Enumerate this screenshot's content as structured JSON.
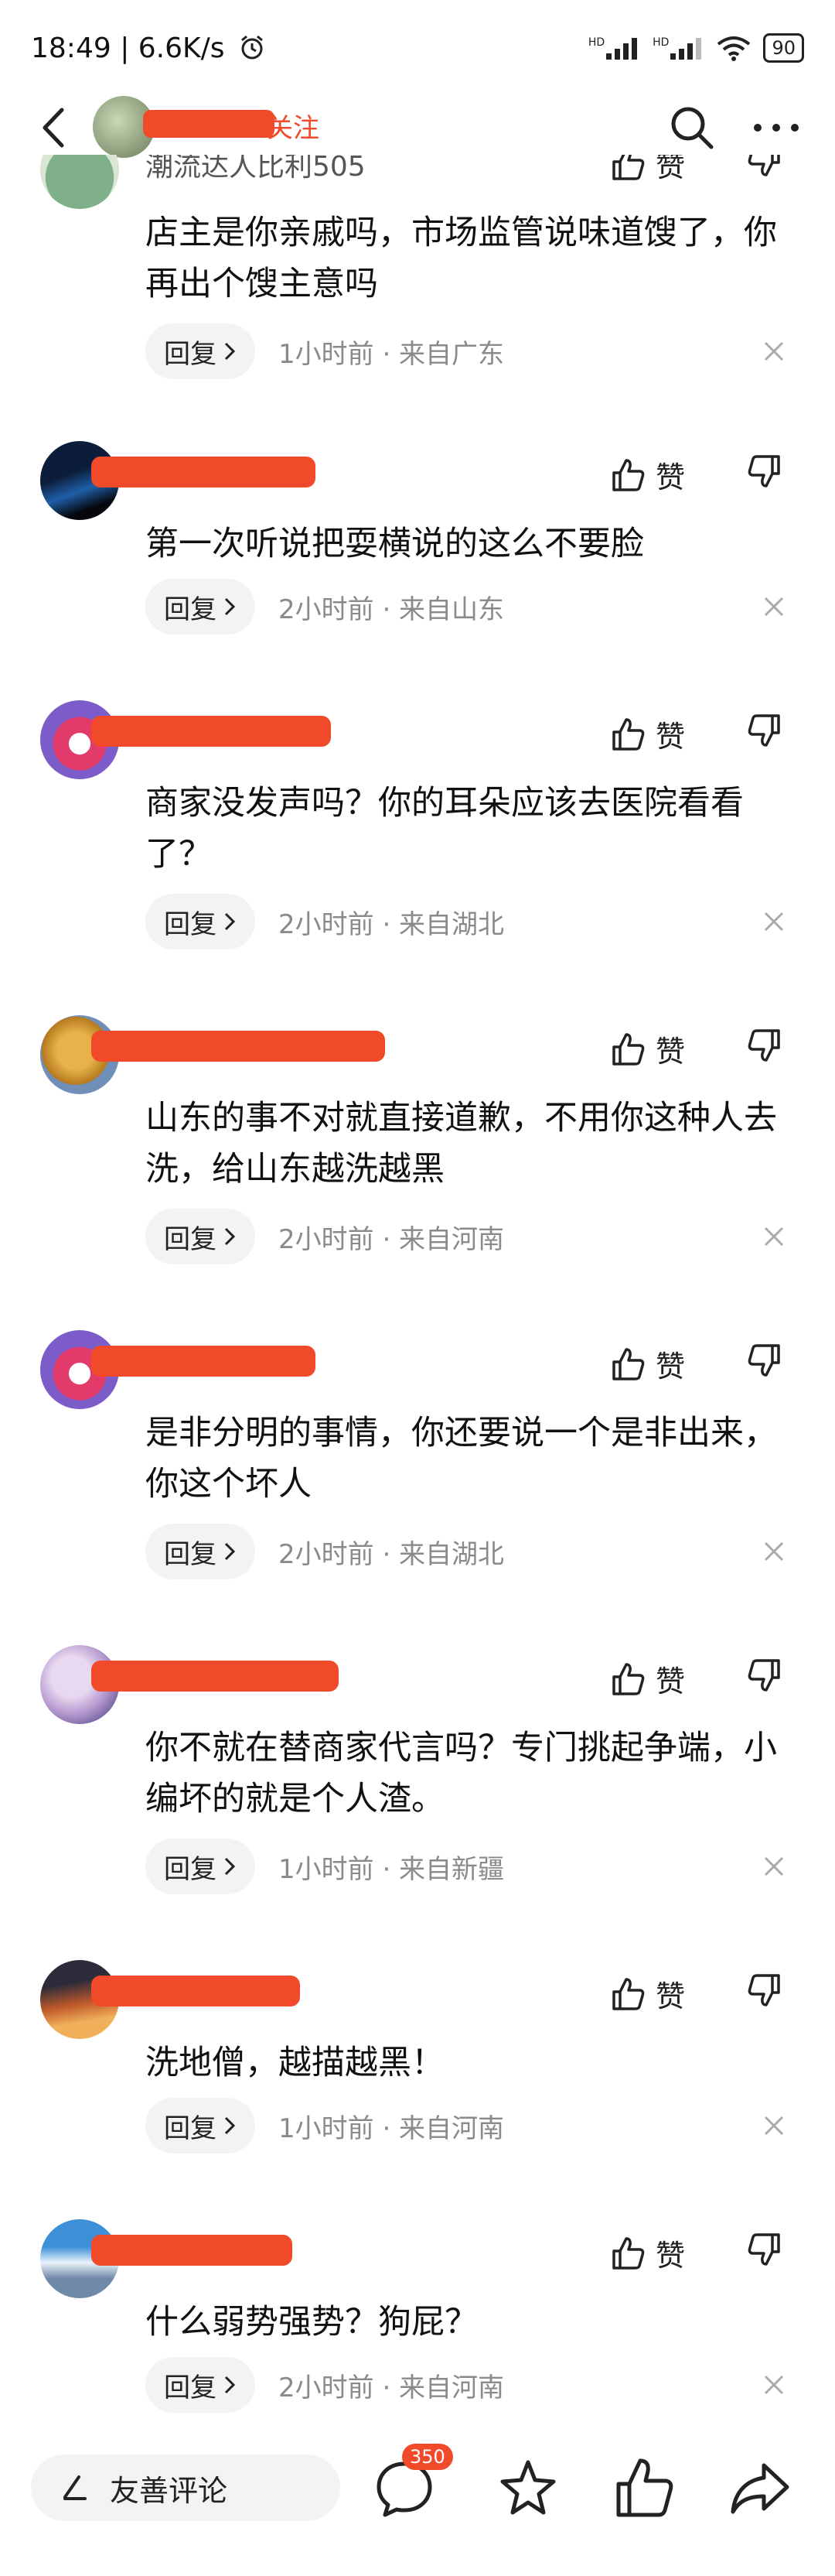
{
  "status": {
    "time": "18:49",
    "speed": "6.6K/s",
    "battery": "90",
    "signal1": "HD",
    "signal2": "HD"
  },
  "header": {
    "follow_label": "关注"
  },
  "comments": [
    {
      "username": "潮流达人比利505",
      "text": "店主是你亲戚吗，市场监管说味道馊了，你再出个馊主意吗",
      "reply_label": "回复",
      "meta": "1小时前 · 来自广东",
      "like_label": "赞"
    },
    {
      "username": "",
      "text": "第一次听说把耍横说的这么不要脸",
      "reply_label": "回复",
      "meta": "2小时前 · 来自山东",
      "like_label": "赞"
    },
    {
      "username": "",
      "text": "商家没发声吗？你的耳朵应该去医院看看了？",
      "reply_label": "回复",
      "meta": "2小时前 · 来自湖北",
      "like_label": "赞"
    },
    {
      "username": "",
      "text": "山东的事不对就直接道歉，不用你这种人去洗，给山东越洗越黑",
      "reply_label": "回复",
      "meta": "2小时前 · 来自河南",
      "like_label": "赞"
    },
    {
      "username": "",
      "text": "是非分明的事情，你还要说一个是非出来，你这个坏人",
      "reply_label": "回复",
      "meta": "2小时前 · 来自湖北",
      "like_label": "赞"
    },
    {
      "username": "",
      "text": "你不就在替商家代言吗？专门挑起争端，小编坏的就是个人渣。",
      "reply_label": "回复",
      "meta": "1小时前 · 来自新疆",
      "like_label": "赞"
    },
    {
      "username": "",
      "text": "洗地僧，越描越黑！",
      "reply_label": "回复",
      "meta": "1小时前 · 来自河南",
      "like_label": "赞"
    },
    {
      "username": "",
      "text": "什么弱势强势？狗屁？",
      "reply_label": "回复",
      "meta": "2小时前 · 来自河南",
      "like_label": "赞"
    }
  ],
  "bottom": {
    "comment_placeholder": "友善评论",
    "comment_count": "350"
  },
  "colors": {
    "accent": "#f04a2a",
    "meta_gray": "#8a8a8a",
    "reply_bg": "#f3f3f3"
  }
}
